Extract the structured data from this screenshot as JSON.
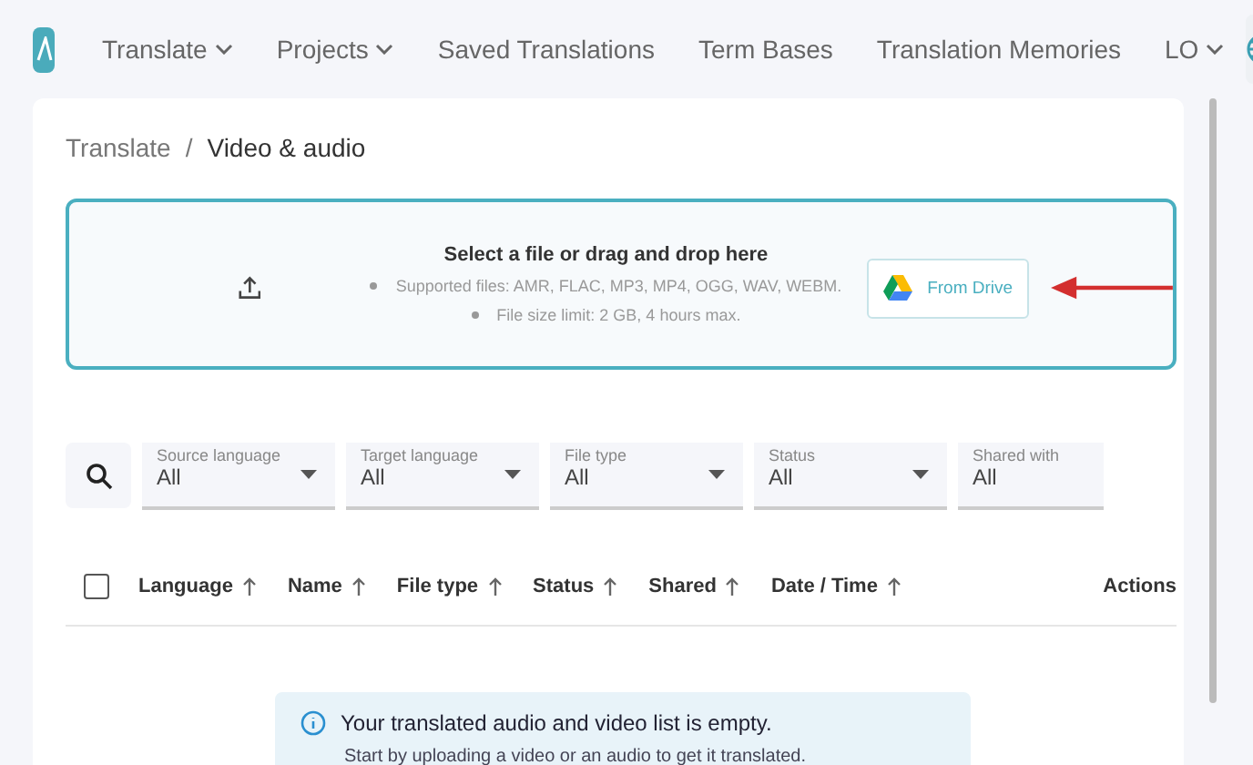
{
  "nav": {
    "items": [
      {
        "label": "Translate",
        "dropdown": true
      },
      {
        "label": "Projects",
        "dropdown": true
      },
      {
        "label": "Saved Translations",
        "dropdown": false
      },
      {
        "label": "Term Bases",
        "dropdown": false
      },
      {
        "label": "Translation Memories",
        "dropdown": false
      },
      {
        "label": "LO",
        "dropdown": true
      }
    ]
  },
  "breadcrumb": {
    "items": [
      "Translate",
      "Video & audio"
    ],
    "separator": "/"
  },
  "upload": {
    "title": "Select a file or drag and drop here",
    "notes": [
      "Supported files: AMR, FLAC, MP3, MP4, OGG, WAV, WEBM.",
      "File size limit: 2 GB, 4 hours max."
    ],
    "drive_button": "From Drive"
  },
  "filters": [
    {
      "label": "Source language",
      "value": "All"
    },
    {
      "label": "Target language",
      "value": "All"
    },
    {
      "label": "File type",
      "value": "All"
    },
    {
      "label": "Status",
      "value": "All"
    },
    {
      "label": "Shared with",
      "value": "All"
    }
  ],
  "table": {
    "select_all": {
      "checked": false
    },
    "columns": [
      {
        "label": "Language",
        "sortable": true
      },
      {
        "label": "Name",
        "sortable": true
      },
      {
        "label": "File type",
        "sortable": true
      },
      {
        "label": "Status",
        "sortable": true
      },
      {
        "label": "Shared",
        "sortable": true
      },
      {
        "label": "Date / Time",
        "sortable": true
      },
      {
        "label": "Actions",
        "sortable": false
      }
    ]
  },
  "empty_notice": {
    "title": "Your translated audio and video list is empty.",
    "text": "Start by uploading a video or an audio to get it translated."
  }
}
